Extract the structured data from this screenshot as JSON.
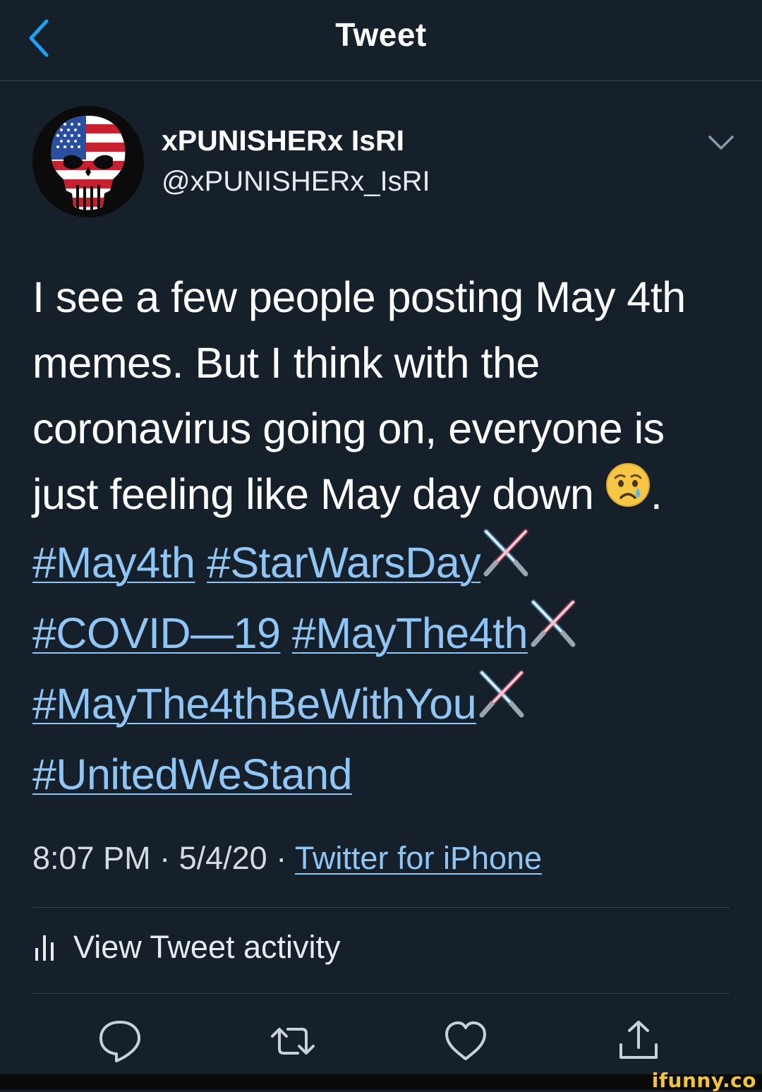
{
  "header": {
    "title": "Tweet",
    "back_icon": "chevron-left-icon"
  },
  "author": {
    "display_name": "xPUNISHERx IsRI",
    "handle": "@xPUNISHERx_IsRI",
    "avatar": "punisher-skull-flag-avatar",
    "menu_icon": "chevron-down-icon"
  },
  "tweet": {
    "line1": "I see a few people posting May 4th",
    "line2": "memes. But I think with the",
    "line3": "coronavirus going on, everyone is",
    "line4_text": "just feeling like May day down ",
    "line4_emoji": "crying-face-emoji",
    "line4_end": ".",
    "hashtags": {
      "may4th": "#May4th",
      "starwarsday": "#StarWarsDay",
      "covid": "#COVID—19",
      "maythe4th": "#MayThe4th",
      "maythe4thbewithyou": "#MayThe4thBeWithYou",
      "unitedwestand": "#UnitedWeStand"
    },
    "saber_emoji": "crossed-lightsabers-emoji"
  },
  "meta": {
    "time": "8:07 PM",
    "separator": " · ",
    "date": "5/4/20",
    "source": "Twitter for iPhone"
  },
  "activity": {
    "label": "View Tweet activity",
    "icon": "bar-chart-icon"
  },
  "actions": {
    "reply_icon": "reply-icon",
    "retweet_icon": "retweet-icon",
    "like_icon": "heart-icon",
    "share_icon": "share-icon"
  },
  "watermark": "ifunny.co",
  "colors": {
    "background": "#15202b",
    "link": "#90c6f5",
    "accent": "#1da1f2",
    "divider": "#38444d"
  }
}
